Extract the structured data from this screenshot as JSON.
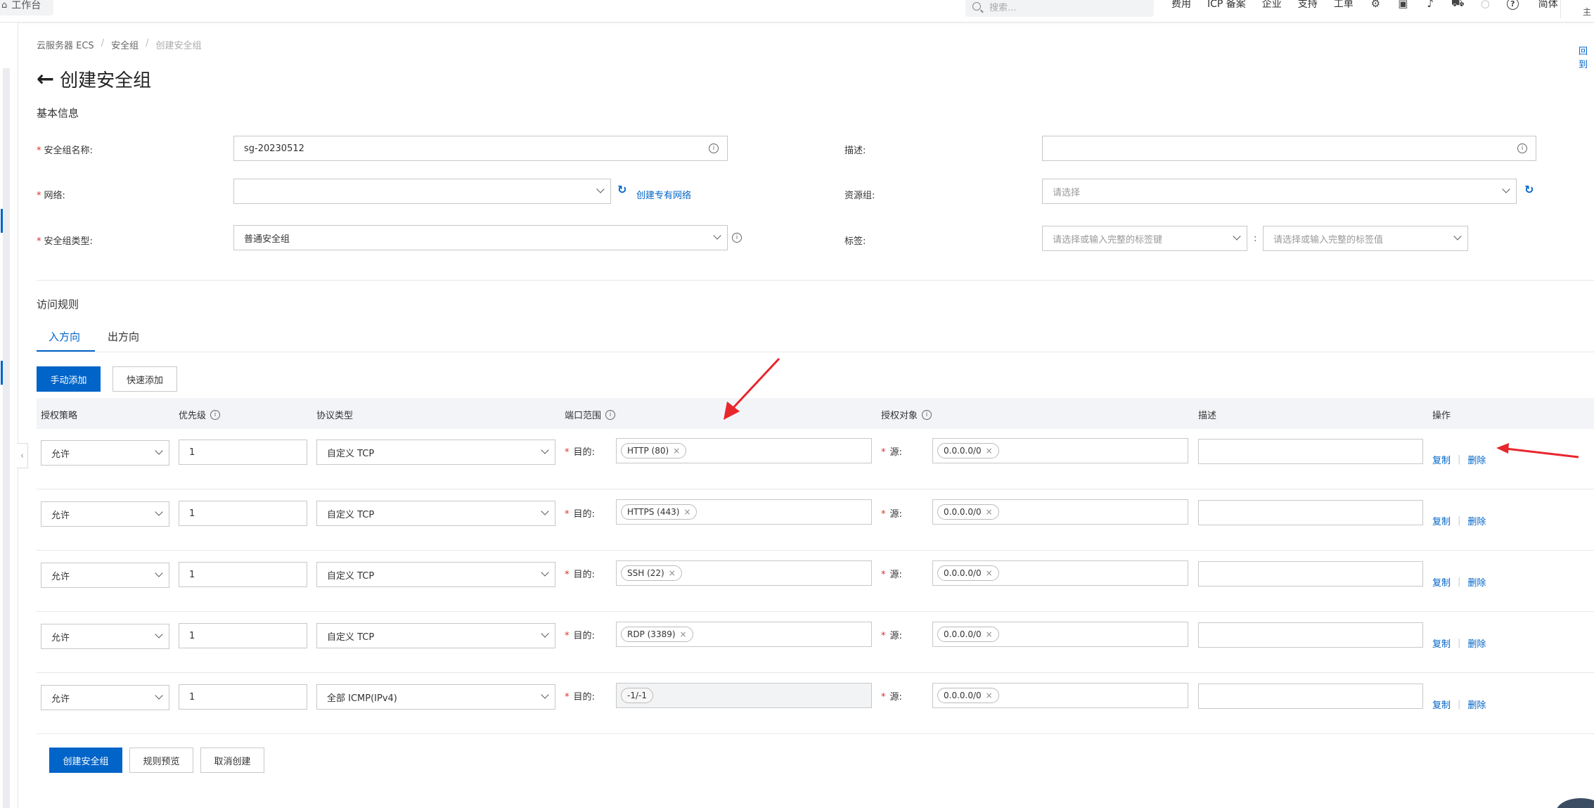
{
  "topbar": {
    "workbench": "工作台",
    "search_placeholder": "搜索...",
    "nav": [
      "费用",
      "ICP 备案",
      "企业",
      "支持",
      "工单"
    ],
    "lang": "简体",
    "corner": "主"
  },
  "breadcrumb": [
    "云服务器 ECS",
    "安全组",
    "创建安全组"
  ],
  "help_link": "回到",
  "title": "创建安全组",
  "basic": {
    "section": "基本信息",
    "name_label": "安全组名称:",
    "name_value": "sg-20230512",
    "network_label": "网络:",
    "network_value": "",
    "create_vpc": "创建专有网络",
    "type_label": "安全组类型:",
    "type_value": "普通安全组",
    "desc_label": "描述:",
    "desc_value": "",
    "rg_label": "资源组:",
    "rg_placeholder": "请选择",
    "tag_label": "标签:",
    "tag_key_placeholder": "请选择或输入完整的标签键",
    "tag_value_placeholder": "请选择或输入完整的标签值"
  },
  "rules": {
    "section": "访问规则",
    "tabs": [
      "入方向",
      "出方向"
    ],
    "add_manual": "手动添加",
    "add_quick": "快速添加",
    "columns": [
      "授权策略",
      "优先级",
      "协议类型",
      "端口范围",
      "授权对象",
      "描述",
      "操作"
    ],
    "dest_label": "目的:",
    "src_label": "源:",
    "copy": "复制",
    "delete": "删除",
    "rows": [
      {
        "policy": "允许",
        "priority": "1",
        "protocol": "自定义 TCP",
        "port": "HTTP (80)",
        "source": "0.0.0.0/0",
        "desc": ""
      },
      {
        "policy": "允许",
        "priority": "1",
        "protocol": "自定义 TCP",
        "port": "HTTPS (443)",
        "source": "0.0.0.0/0",
        "desc": ""
      },
      {
        "policy": "允许",
        "priority": "1",
        "protocol": "自定义 TCP",
        "port": "SSH (22)",
        "source": "0.0.0.0/0",
        "desc": ""
      },
      {
        "policy": "允许",
        "priority": "1",
        "protocol": "自定义 TCP",
        "port": "RDP (3389)",
        "source": "0.0.0.0/0",
        "desc": ""
      },
      {
        "policy": "允许",
        "priority": "1",
        "protocol": "全部 ICMP(IPv4)",
        "port": "-1/-1",
        "source": "0.0.0.0/0",
        "desc": ""
      }
    ]
  },
  "footer": {
    "create": "创建安全组",
    "preview": "规则预览",
    "cancel": "取消创建"
  },
  "colors": {
    "accent": "#0064c8",
    "required": "#d93026",
    "annotation_arrow": "#e8262d"
  }
}
